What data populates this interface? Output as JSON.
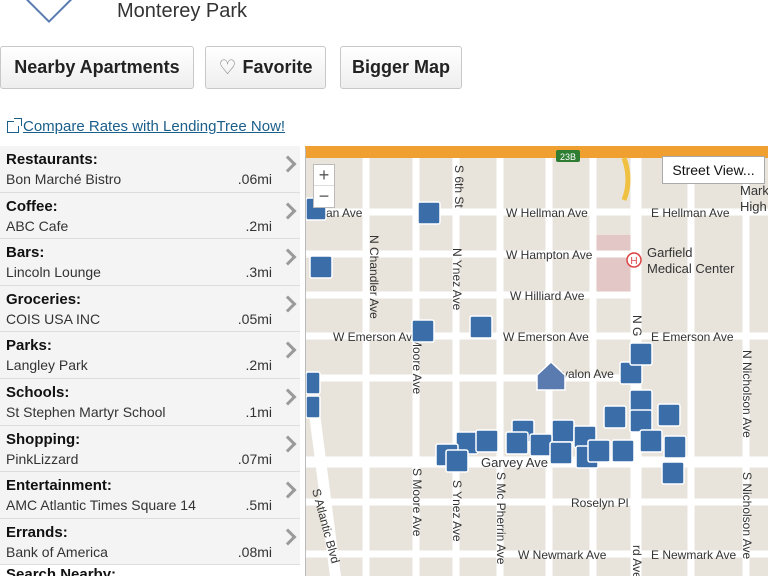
{
  "header": {
    "city": "Monterey Park"
  },
  "buttons": {
    "nearby": "Nearby Apartments",
    "favorite": "Favorite",
    "bigger_map": "Bigger Map"
  },
  "compare_link": "Compare Rates with LendingTree Now!",
  "categories": [
    {
      "label": "Restaurants:",
      "name": "Bon Marché Bistro",
      "distance": ".06mi"
    },
    {
      "label": "Coffee:",
      "name": "ABC Cafe",
      "distance": ".2mi"
    },
    {
      "label": "Bars:",
      "name": "Lincoln Lounge",
      "distance": ".3mi"
    },
    {
      "label": "Groceries:",
      "name": "COIS USA INC",
      "distance": ".05mi"
    },
    {
      "label": "Parks:",
      "name": "Langley Park",
      "distance": ".2mi"
    },
    {
      "label": "Schools:",
      "name": "St Stephen Martyr School",
      "distance": ".1mi"
    },
    {
      "label": "Shopping:",
      "name": "PinkLizzard",
      "distance": ".07mi"
    },
    {
      "label": "Entertainment:",
      "name": "AMC Atlantic Times Square 14",
      "distance": ".5mi"
    },
    {
      "label": "Errands:",
      "name": "Bank of America",
      "distance": ".08mi"
    }
  ],
  "search_nearby": "Search Nearby:",
  "map": {
    "street_view": "Street View...",
    "zoom_in": "+",
    "zoom_out": "−",
    "highway_shield": "23B",
    "streets": {
      "hellman_w": "W Hellman Ave",
      "hellman_e": "E Hellman Ave",
      "hellman_left": "man Ave",
      "hampton": "W Hampton Ave",
      "hilliard": "W Hilliard Ave",
      "emerson_w": "W Emerson Ave",
      "emerson_e": "E Emerson Ave",
      "garvey": "Garvey Ave",
      "roselyn": "Roselyn Pl",
      "newmark_w": "W Newmark Ave",
      "newmark_e": "E Newmark Ave",
      "sixth": "S 6th St",
      "chandler": "N Chandler Ave",
      "ynez_n": "N Ynez Ave",
      "moore_n": "N Moore Ave",
      "moore_s": "S Moore Ave",
      "ynez_s": "S Ynez Ave",
      "mcpherrin": "S Mc Pherrin Ave",
      "atlantic": "S Atlantic Blvd",
      "nicholson_n": "N Nicholson Ave",
      "nicholson_s": "S Nicholson Ave",
      "garfield_n": "N G",
      "garfield_s": "rd Ave",
      "garfield_label": "Garvalon Ave"
    },
    "poi_garfield_1": "Garfield",
    "poi_garfield_2": "Medical Center",
    "poi_edge_1": "Mark",
    "poi_edge_2": "High",
    "hospital_letter": "H"
  }
}
